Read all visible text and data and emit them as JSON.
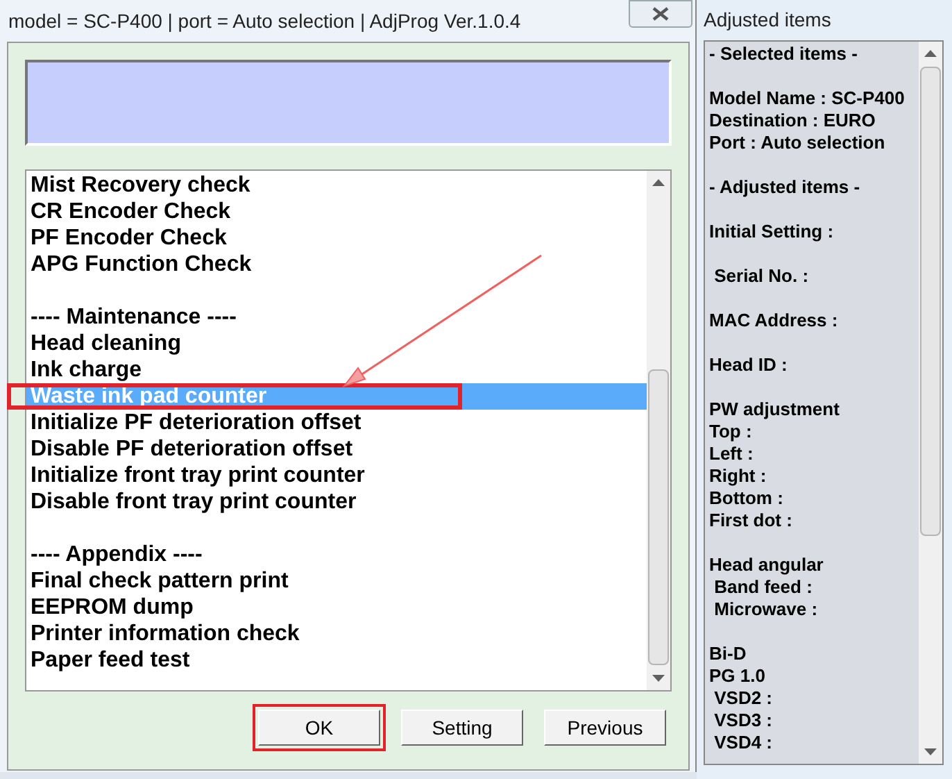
{
  "window": {
    "title": "model = SC-P400 | port = Auto selection | AdjProg Ver.1.0.4"
  },
  "menu_list": {
    "groups": [
      {
        "items": [
          {
            "label": "Mist Recovery check",
            "selected": false
          },
          {
            "label": "CR Encoder Check",
            "selected": false
          },
          {
            "label": "PF Encoder Check",
            "selected": false
          },
          {
            "label": "APG Function Check",
            "selected": false
          }
        ]
      },
      {
        "heading": "---- Maintenance ----",
        "items": [
          {
            "label": "Head cleaning",
            "selected": false
          },
          {
            "label": "Ink charge",
            "selected": false
          },
          {
            "label": "Waste ink pad counter",
            "selected": true
          },
          {
            "label": "Initialize PF deterioration offset",
            "selected": false
          },
          {
            "label": "Disable PF deterioration offset",
            "selected": false
          },
          {
            "label": "Initialize front tray print counter",
            "selected": false
          },
          {
            "label": "Disable front tray print counter",
            "selected": false
          }
        ]
      },
      {
        "heading": "---- Appendix ----",
        "items": [
          {
            "label": "Final check pattern print",
            "selected": false
          },
          {
            "label": "EEPROM dump",
            "selected": false
          },
          {
            "label": "Printer information check",
            "selected": false
          },
          {
            "label": "Paper feed test",
            "selected": false
          }
        ]
      }
    ]
  },
  "buttons": [
    {
      "label": "OK",
      "highlighted": true
    },
    {
      "label": "Setting",
      "highlighted": false
    },
    {
      "label": "Previous",
      "highlighted": false
    }
  ],
  "adjusted_panel": {
    "title": "Adjusted items",
    "groups": [
      [
        "- Selected items -"
      ],
      [
        "Model Name : SC-P400",
        "Destination : EURO",
        "Port : Auto selection"
      ],
      [
        "- Adjusted items -"
      ],
      [
        "Initial Setting :"
      ],
      [
        " Serial No. :"
      ],
      [
        "MAC Address :"
      ],
      [
        "Head ID :"
      ],
      [
        "PW adjustment",
        "Top :",
        "Left :",
        "Right :",
        "Bottom :",
        "First dot :"
      ],
      [
        "Head angular",
        " Band feed :",
        " Microwave :"
      ],
      [
        "Bi-D",
        "PG 1.0",
        " VSD2 :",
        " VSD3 :",
        " VSD4 :"
      ]
    ]
  }
}
